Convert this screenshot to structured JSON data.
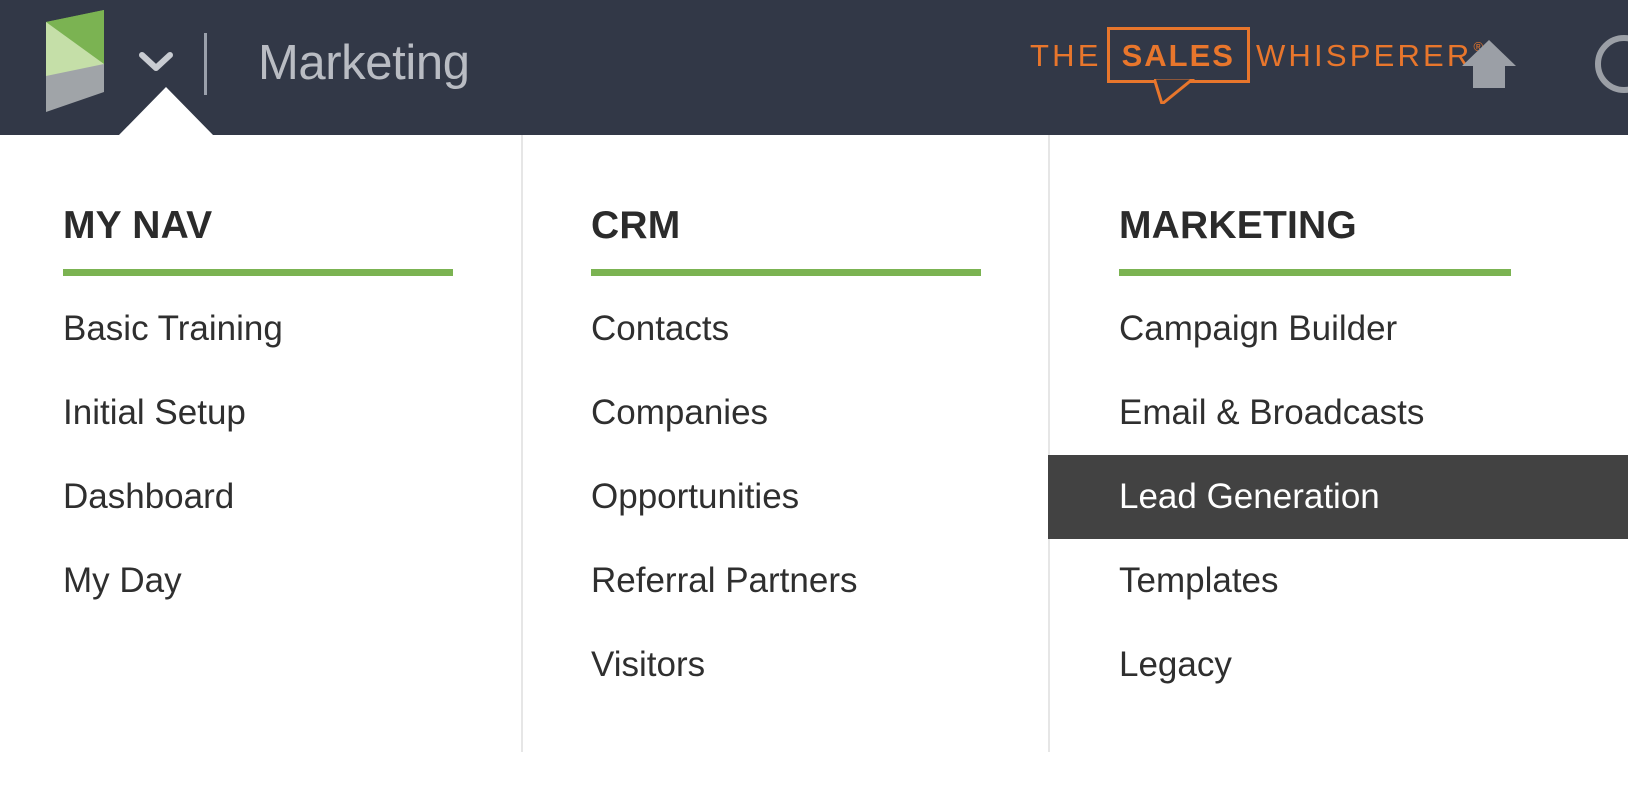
{
  "header": {
    "logo_name": "infusionsoft-logo",
    "brand_caret_label": "chevron-down-icon",
    "app_title": "Marketing",
    "partner_logo": {
      "the": "THE",
      "sales": "SALES",
      "whisperer": "WHISPERER",
      "registered": "®"
    },
    "icons": [
      {
        "name": "home-icon",
        "label": "Home"
      },
      {
        "name": "help-circle-icon",
        "label": "Help"
      }
    ],
    "colors": {
      "bar_background": "#323847",
      "title_text": "#b9bcc3",
      "partner_orange": "#e8762c"
    }
  },
  "dropdown": {
    "accent_green": "#7bb352",
    "active_background": "#424242",
    "columns": [
      {
        "title": "MY NAV",
        "items": [
          {
            "label": "Basic Training",
            "active": false
          },
          {
            "label": "Initial Setup",
            "active": false
          },
          {
            "label": "Dashboard",
            "active": false
          },
          {
            "label": "My Day",
            "active": false
          }
        ]
      },
      {
        "title": "CRM",
        "items": [
          {
            "label": "Contacts",
            "active": false
          },
          {
            "label": "Companies",
            "active": false
          },
          {
            "label": "Opportunities",
            "active": false
          },
          {
            "label": "Referral Partners",
            "active": false
          },
          {
            "label": "Visitors",
            "active": false
          }
        ]
      },
      {
        "title": "MARKETING",
        "items": [
          {
            "label": "Campaign Builder",
            "active": false
          },
          {
            "label": "Email & Broadcasts",
            "active": false
          },
          {
            "label": "Lead Generation",
            "active": true
          },
          {
            "label": "Templates",
            "active": false
          },
          {
            "label": "Legacy",
            "active": false
          }
        ]
      }
    ]
  }
}
